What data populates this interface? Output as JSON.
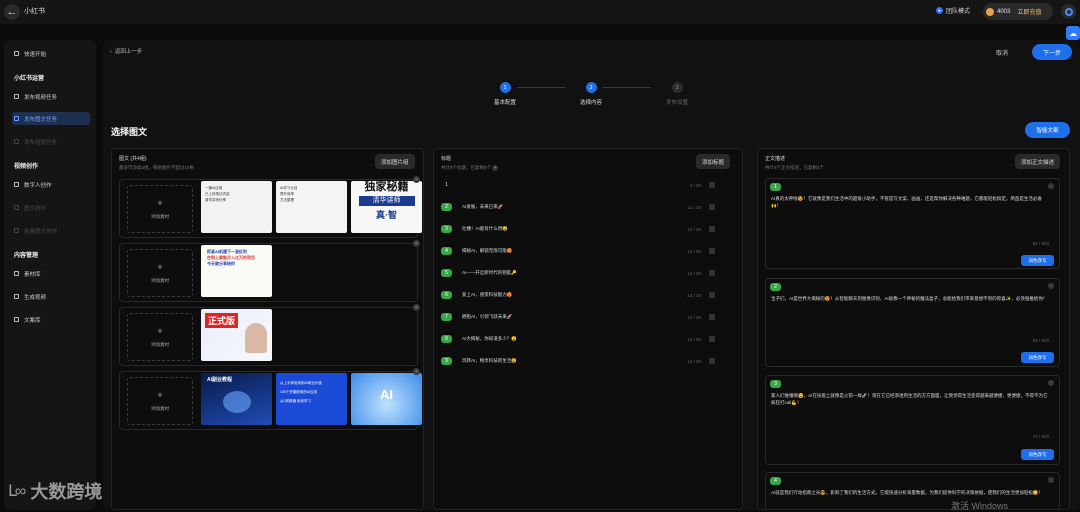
{
  "topbar": {
    "app_title": "小红书",
    "team_label": "团队模式",
    "credits_value": "4003",
    "recharge_label": "立即充值"
  },
  "sidebar": {
    "quick_start": "快速开始",
    "section_ops": "小红书运营",
    "publish_video": "发布视频任务",
    "publish_image": "发布图文任务",
    "disabled_1": "发布组图任务",
    "section_create": "视频创作",
    "digital_human": "数字人创作",
    "disabled_2": "图文创作",
    "disabled_3": "批量图文创作",
    "section_content": "内容管理",
    "material": "素材库",
    "gen_video": "生成视频",
    "copy_lib": "文案库"
  },
  "header": {
    "back_label": "返回上一步",
    "cancel_label": "取消",
    "next_label": "下一步"
  },
  "steps": [
    {
      "num": "1",
      "label": "基本配置"
    },
    {
      "num": "2",
      "label": "选择内容"
    },
    {
      "num": "3",
      "label": "发布设置"
    }
  ],
  "page_title": "选择图文",
  "ai_button": "智能文案",
  "images_panel": {
    "title": "图文 (共4组)",
    "subtitle": "最多可添加4组，每组图片不超过10张",
    "add_group_button": "添加图片组",
    "add_label": "添加素材",
    "thumbs": [
      {
        "lines": [
          "一篇AI应用",
          "已上传笔记内容",
          "清华讲师分享"
        ]
      },
      {
        "lines": [
          "AI学习计划",
          "提升效率",
          "方法整理"
        ]
      },
      {
        "lines": [
          "AI应用教程",
          "实操步骤",
          "干货合集"
        ]
      },
      {
        "big1": "独家秘籍",
        "big2": "清华讲师",
        "big3": "真·智"
      },
      {
        "l1": "抓紧AI机遇下一波红利",
        "l2": "在网上就能月入过万的项目",
        "l3": "今天就分享给你"
      },
      {
        "big": "正式版"
      },
      {
        "banner": "AI副业教程"
      },
      {
        "lines": [
          "从上手体验用到AI商业价值",
          "100个开箱即用的AI应用",
          "从0到精通 系统学习"
        ]
      },
      {
        "label": "AI"
      }
    ]
  },
  "titles_panel": {
    "title": "标题",
    "subtitle": "共计9个标题，已复制9个",
    "add_button": "添加标题",
    "rows": [
      {
        "num": "1",
        "text": "",
        "count": "0 / 20"
      },
      {
        "num": "2",
        "text": "AI发展，未来已来🚀",
        "count": "11 / 20"
      },
      {
        "num": "3",
        "text": "吐槽！AI能有什么用😅",
        "count": "12 / 20"
      },
      {
        "num": "4",
        "text": "揭秘AI，解锁无限可能😍",
        "count": "13 / 20"
      },
      {
        "num": "5",
        "text": "AI——开启新时代的钥匙🔑",
        "count": "14 / 20"
      },
      {
        "num": "6",
        "text": "爱上AI，感受科技魅力😍",
        "count": "13 / 20"
      },
      {
        "num": "7",
        "text": "拥抱AI，引领飞跃未来🚀",
        "count": "12 / 20"
      },
      {
        "num": "8",
        "text": "AI大揭秘，你知道多少？😮",
        "count": "13 / 20"
      },
      {
        "num": "9",
        "text": "玩转AI，畅享科技新生活😃",
        "count": "14 / 20"
      }
    ]
  },
  "body_panel": {
    "title": "正文描述",
    "subtitle": "共计4个正文描述，已复制4个",
    "add_button": "添加正文描述",
    "rewrite_label": "润色改写",
    "cards": [
      {
        "num": "1",
        "text": "AI真的太神啦😍！它就像是我们生活中的超级小助手，不管是写文案、画画，还是帮你解决各种难题，它都能轻松搞定。简直是生活必备🙌！",
        "count": "85 / 800"
      },
      {
        "num": "2",
        "text": "宝子们，AI是世界大揭秘的😍！从智能聊天到图像识别，AI就像一个神秘的魔法盒子，总能给我们带来意想不到的惊喜✨，必须强推给你！",
        "count": "84 / 800"
      },
      {
        "num": "3",
        "text": "家人们谁懂啊😭，AI在技能上就像是火箭一样🚀！现在它已经渗透到生活的方方面面，让我觉得生活变得越来越便捷、更便捷，不得不为它疯狂打call💪！",
        "count": "73 / 800"
      },
      {
        "num": "4",
        "text": "AI就是我们行动指南之光😎，影响了我们的生活方式。它能快速分析海量数据，为我们提供科学的决策依据，使我们的生活更加轻松😊！",
        "count": ""
      }
    ]
  },
  "watermark": "大数跨境",
  "os_notice": "激活 Windows"
}
